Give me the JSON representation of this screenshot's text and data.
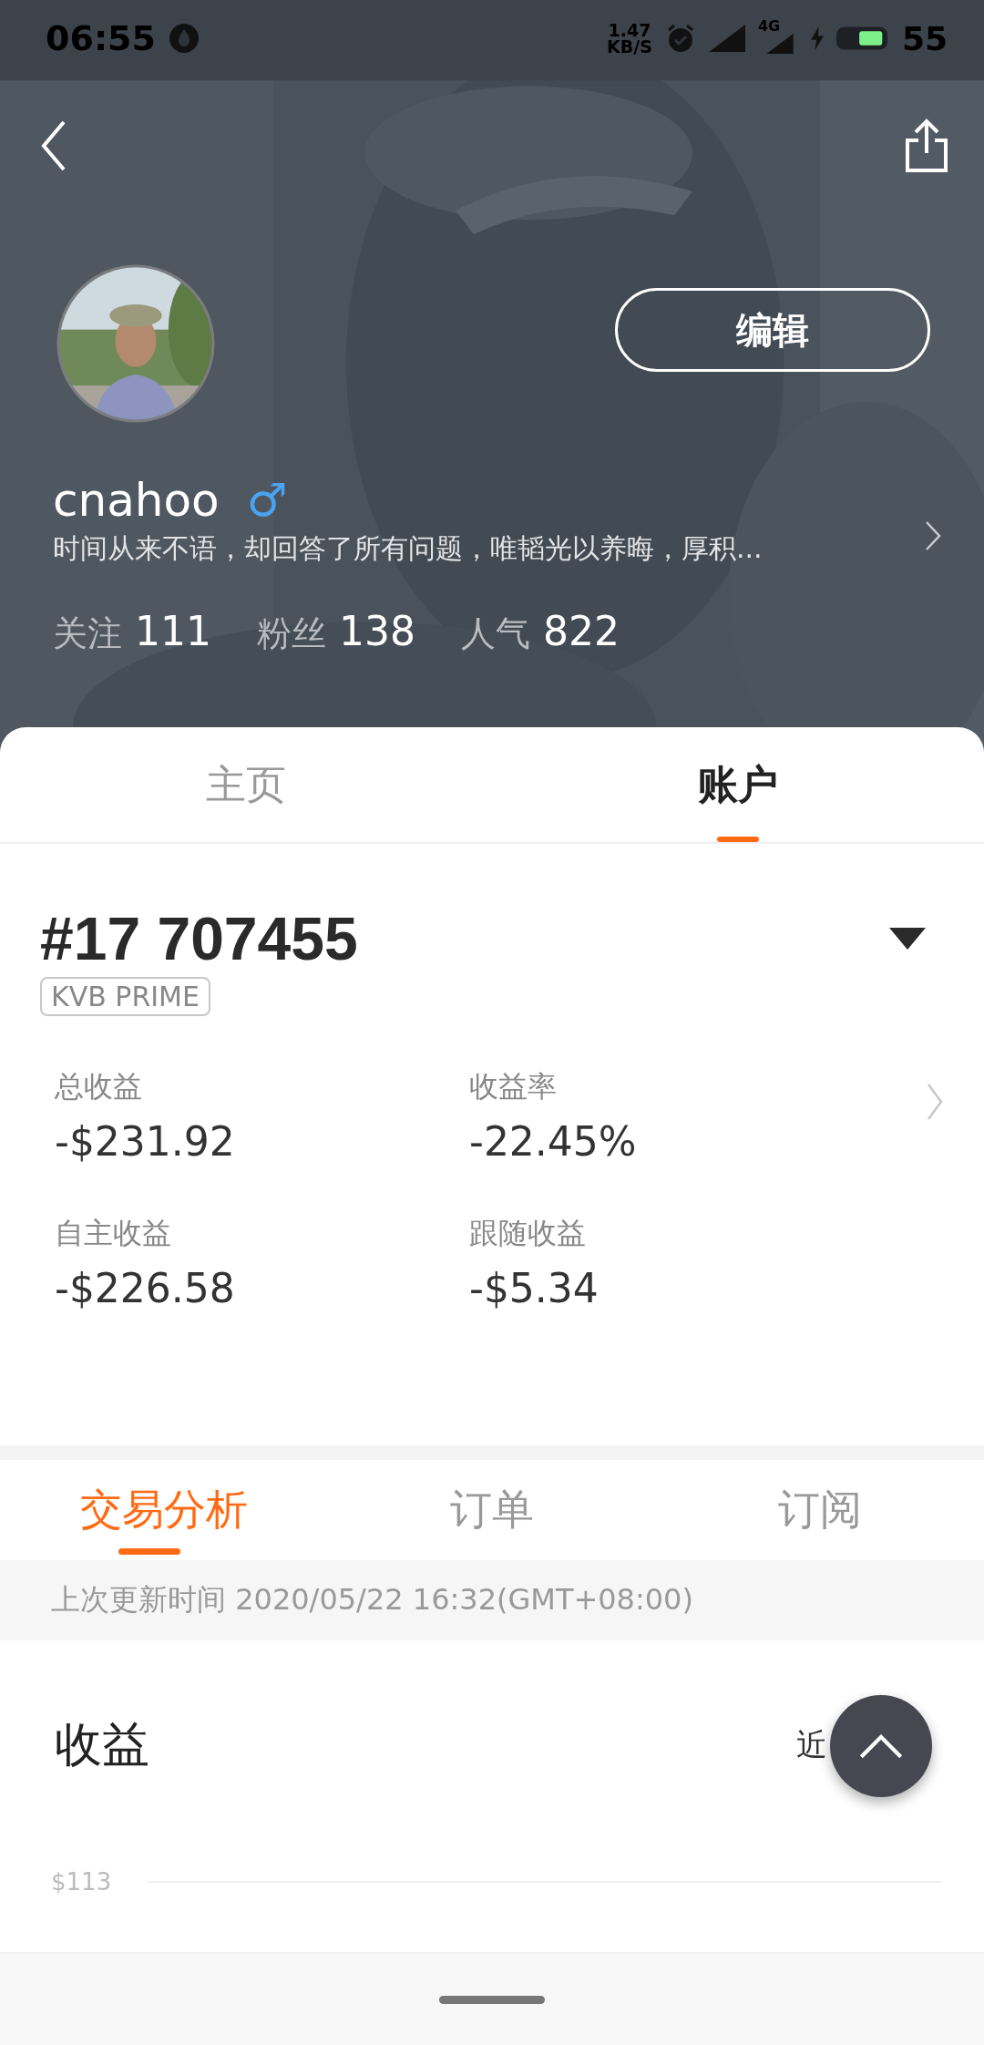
{
  "status_bar": {
    "time": "06:55",
    "net_speed_value": "1.47",
    "net_speed_unit": "KB/S",
    "network_type": "4G",
    "battery": "55"
  },
  "profile": {
    "edit_button": "编辑",
    "name": "cnahoo",
    "gender_symbol": "♂",
    "bio": "时间从来不语，却回答了所有问题，唯韬光以养晦，厚积...",
    "stats": [
      {
        "label": "关注",
        "value": "111"
      },
      {
        "label": "粉丝",
        "value": "138"
      },
      {
        "label": "人气",
        "value": "822"
      }
    ]
  },
  "tabs": [
    {
      "label": "主页",
      "selected": false
    },
    {
      "label": "账户",
      "selected": true
    }
  ],
  "account": {
    "number": "#17 707455",
    "tag": "KVB PRIME",
    "metrics": [
      {
        "label": "总收益",
        "value": "-$231.92"
      },
      {
        "label": "收益率",
        "value": "-22.45%"
      },
      {
        "label": "自主收益",
        "value": "-$226.58"
      },
      {
        "label": "跟随收益",
        "value": "-$5.34"
      }
    ]
  },
  "sub_tabs": [
    {
      "label": "交易分析",
      "selected": true
    },
    {
      "label": "订单",
      "selected": false
    },
    {
      "label": "订阅",
      "selected": false
    }
  ],
  "update_time": "上次更新时间 2020/05/22 16:32(GMT+08:00)",
  "earnings": {
    "title": "收益",
    "period": "近",
    "y_tick": "$113"
  }
}
